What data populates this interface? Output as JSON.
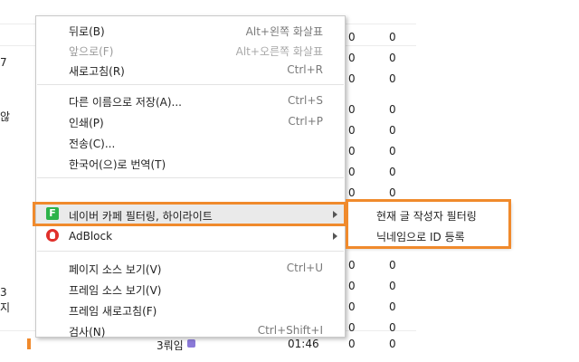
{
  "background": {
    "left_fragments": [
      "7",
      "않",
      "3",
      "지"
    ],
    "rows": [
      {
        "a": "0",
        "b": "0"
      },
      {
        "a": "0",
        "b": "0"
      },
      {
        "a": "0",
        "b": "0"
      },
      {
        "a": "0",
        "b": "0"
      },
      {
        "a": "0",
        "b": "0"
      },
      {
        "a": "0",
        "b": "0"
      },
      {
        "a": "0",
        "b": "0"
      },
      {
        "a": "0",
        "b": "0"
      },
      {
        "a": "0",
        "b": "0"
      },
      {
        "a": "0",
        "b": "0"
      },
      {
        "a": "0",
        "b": "0"
      },
      {
        "a": "0",
        "b": "0"
      },
      {
        "a": "0",
        "b": "0"
      },
      {
        "a": "0",
        "b": "0"
      },
      {
        "a": "0",
        "b": "0"
      },
      {
        "a": "0",
        "b": "0"
      }
    ],
    "last_row": {
      "author": "3뤄임",
      "time": "01:46"
    }
  },
  "menu": {
    "back": {
      "label": "뒤로(B)",
      "shortcut": "Alt+왼쪽 화살표"
    },
    "forward": {
      "label": "앞으로(F)",
      "shortcut": "Alt+오른쪽 화살표"
    },
    "reload": {
      "label": "새로고침(R)",
      "shortcut": "Ctrl+R"
    },
    "save_as": {
      "label": "다른 이름으로 저장(A)...",
      "shortcut": "Ctrl+S"
    },
    "print": {
      "label": "인쇄(P)",
      "shortcut": "Ctrl+P"
    },
    "cast": {
      "label": "전송(C)..."
    },
    "translate": {
      "label": "한국어(으)로 번역(T)"
    },
    "naver": {
      "label": "네이버 카페 필터링, 하이라이트",
      "icon_char": "F"
    },
    "adblock": {
      "label": "AdBlock"
    },
    "view_source": {
      "label": "페이지 소스 보기(V)",
      "shortcut": "Ctrl+U"
    },
    "frame_source": {
      "label": "프레임 소스 보기(V)"
    },
    "frame_reload": {
      "label": "프레임 새로고침(F)"
    },
    "inspect": {
      "label": "검사(N)",
      "shortcut": "Ctrl+Shift+I"
    }
  },
  "submenu": {
    "filter_author": "현재 글 작성자 필터링",
    "register_nick": "닉네임으로 ID 등록"
  },
  "colors": {
    "highlight_border": "#f08a2c",
    "naver_icon": "#2db34a",
    "adblock_icon": "#e0302b"
  }
}
